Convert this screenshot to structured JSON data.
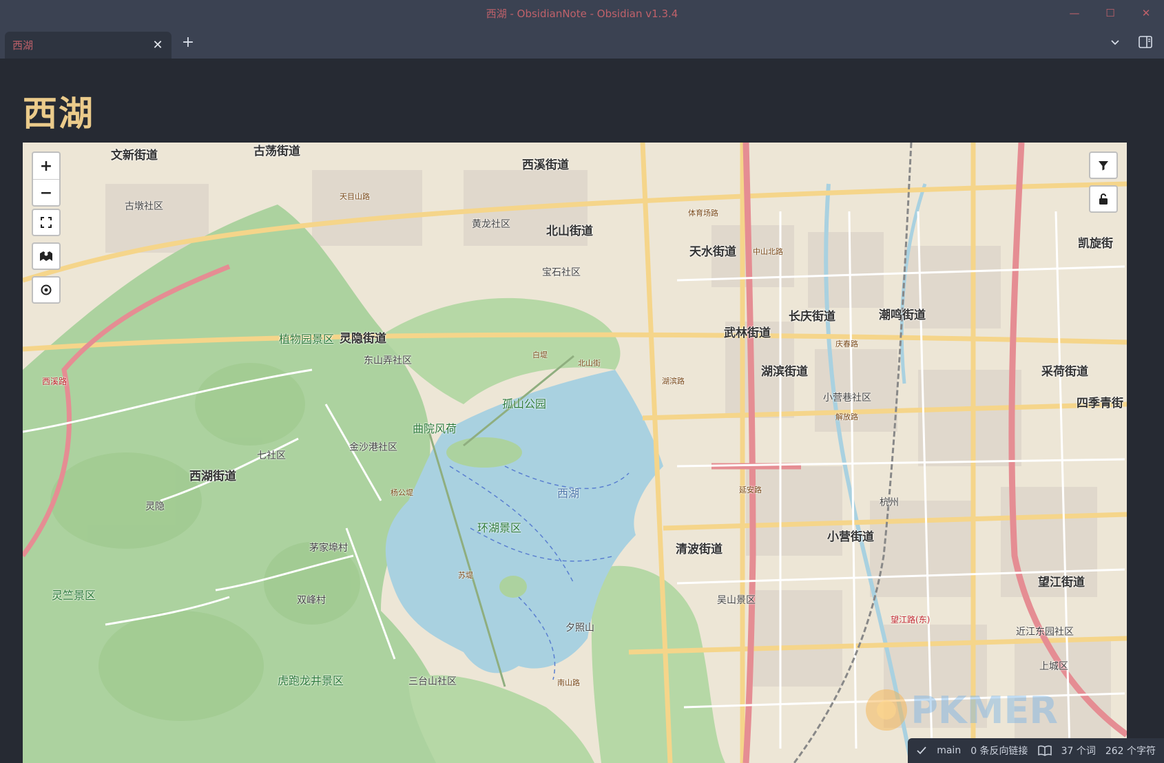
{
  "window": {
    "title": "西湖 - ObsidianNote - Obsidian v1.3.4",
    "minimize": "—",
    "maximize": "☐",
    "close": "✕"
  },
  "tabs": [
    {
      "label": "西湖",
      "close": "✕"
    }
  ],
  "tabbar": {
    "new_tab": "+"
  },
  "note": {
    "title": "西湖"
  },
  "map": {
    "zoom_in": "+",
    "zoom_out": "−",
    "labels": {
      "xihu_jiedao": "西湖街道",
      "xihu": "西湖",
      "huanhu": "环湖景区",
      "lingyin": "灵隐街道",
      "zhiwuyuan": "植物园景区",
      "beishan": "北山街道",
      "tianshui": "天水街道",
      "wulin": "武林街道",
      "hubin": "湖滨街道",
      "changqing": "长庆街道",
      "chaoming": "潮鸣街道",
      "caihe": "采荷街道",
      "siqing": "四季青街",
      "xiaoying": "小营街道",
      "qingbo": "清波街道",
      "wangjiang": "望江街道",
      "lingzhu": "灵竺景区",
      "hupao": "虎跑龙井景区",
      "xixi": "西溪街道",
      "wenxin": "文新街道",
      "gudang": "古荡街道",
      "kaixuan": "凯旋街",
      "gushan": "孤山公园",
      "quyuan": "曲院风荷",
      "jinsha": "金沙港社区",
      "qishe": "七社区",
      "huanghuang": "黄龙社区",
      "baoshi": "宝石社区",
      "dongshan": "东山弄社区",
      "shangcheng": "上城区",
      "wushan": "吴山景区",
      "santai": "三台山社区",
      "xiaoyingroad": "小营巷社区",
      "tianmushan": "天目山路",
      "tiyuchang": "体育场路",
      "yanan": "延安路",
      "zhongshan": "中山北路",
      "qingchun": "庆春路",
      "jiefang": "解放路",
      "nanshan": "南山路",
      "hupan": "湖滨路",
      "beishanroad": "北山街",
      "sudi": "苏堤",
      "baidi": "白堤",
      "yangdi": "杨公堤",
      "xixiroad": "西溪路",
      "hangzhou": "杭州",
      "linping": "灵隐",
      "xuefu": "古墩社区",
      "maojiabu": "茅家埠村",
      "longjing": "双峰村",
      "leifeng": "夕照山",
      "wangjiangroad": "望江路(东)",
      "jiangcheng": "近江东园社区"
    }
  },
  "watermark": {
    "text": "PKMER"
  },
  "statusbar": {
    "branch": "main",
    "backlinks": "0 条反向链接",
    "words": "37 个词",
    "chars": "262 个字符"
  }
}
